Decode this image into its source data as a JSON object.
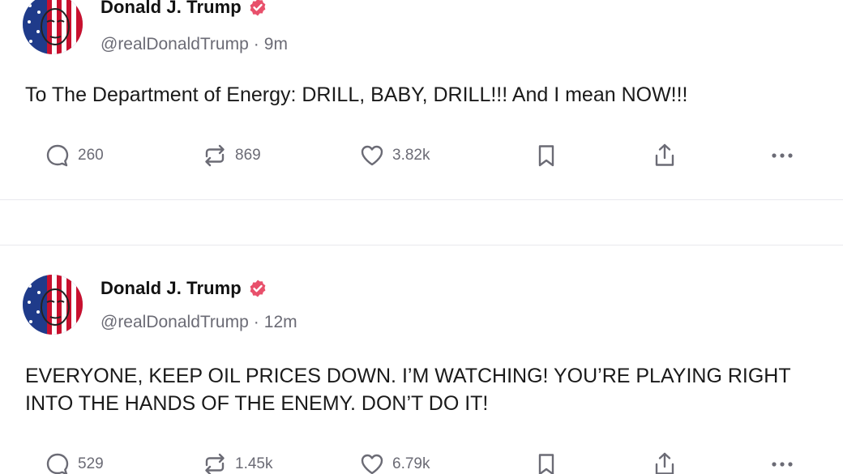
{
  "posts": [
    {
      "author": "Donald J. Trump",
      "handle": "@realDonaldTrump",
      "separator": "·",
      "time": "9m",
      "text": "To The Department of Energy: DRILL, BABY, DRILL!!!  And I mean NOW!!!",
      "replies": "260",
      "reposts": "869",
      "likes": "3.82k"
    },
    {
      "author": "Donald J. Trump",
      "handle": "@realDonaldTrump",
      "separator": "·",
      "time": "12m",
      "text": "EVERYONE, KEEP OIL PRICES DOWN. I’M WATCHING! YOU’RE PLAYING RIGHT INTO THE HANDS OF THE ENEMY. DON’T DO IT!",
      "replies": "529",
      "reposts": "1.45k",
      "likes": "6.79k"
    }
  ],
  "icons": {
    "reply": "comment-icon",
    "repost": "repost-icon",
    "like": "heart-icon",
    "bookmark": "bookmark-icon",
    "share": "share-icon",
    "more": "more-options-icon",
    "verified": "verified-badge-icon"
  },
  "colors": {
    "verified_badge": "#e8506b",
    "icon_gray": "#6b6b75",
    "divider": "#e9e9ee"
  }
}
